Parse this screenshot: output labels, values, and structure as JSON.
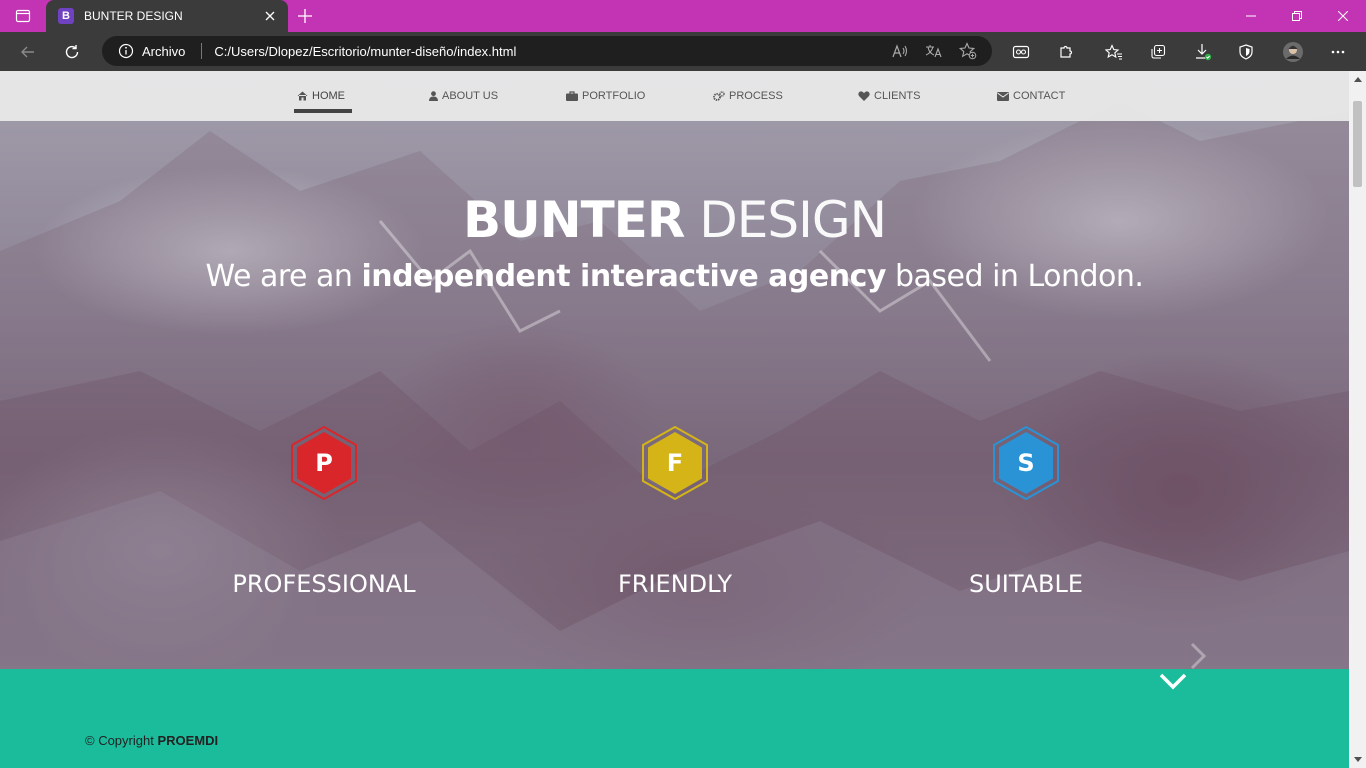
{
  "browser": {
    "tab": {
      "favicon_letter": "B",
      "title": "BUNTER DESIGN"
    },
    "address_label": "Archivo",
    "url": "C:/Users/Dlopez/Escritorio/munter-diseño/index.html"
  },
  "nav": {
    "items": [
      {
        "label": "HOME",
        "icon": "home-icon",
        "active": true
      },
      {
        "label": "ABOUT US",
        "icon": "user-icon"
      },
      {
        "label": "PORTFOLIO",
        "icon": "briefcase-icon"
      },
      {
        "label": "PROCESS",
        "icon": "gears-icon"
      },
      {
        "label": "CLIENTS",
        "icon": "heart-icon"
      },
      {
        "label": "CONTACT",
        "icon": "envelope-icon"
      }
    ]
  },
  "hero": {
    "title_bold": "BUNTER",
    "title_light": "DESIGN",
    "sub_pre": "We are an ",
    "sub_bold": "independent interactive agency",
    "sub_post": " based in London."
  },
  "features": [
    {
      "letter": "P",
      "label": "PROFESSIONAL",
      "color": "#d9262a"
    },
    {
      "letter": "F",
      "label": "FRIENDLY",
      "color": "#d4b417"
    },
    {
      "letter": "S",
      "label": "SUITABLE",
      "color": "#2a93d5"
    }
  ],
  "footer": {
    "copyright_pre": "© Copyright ",
    "copyright_brand": "PROEMDI"
  },
  "colors": {
    "titlebar": "#c234b4",
    "toolbar": "#3b3b3b",
    "footer": "#1abc9c"
  }
}
